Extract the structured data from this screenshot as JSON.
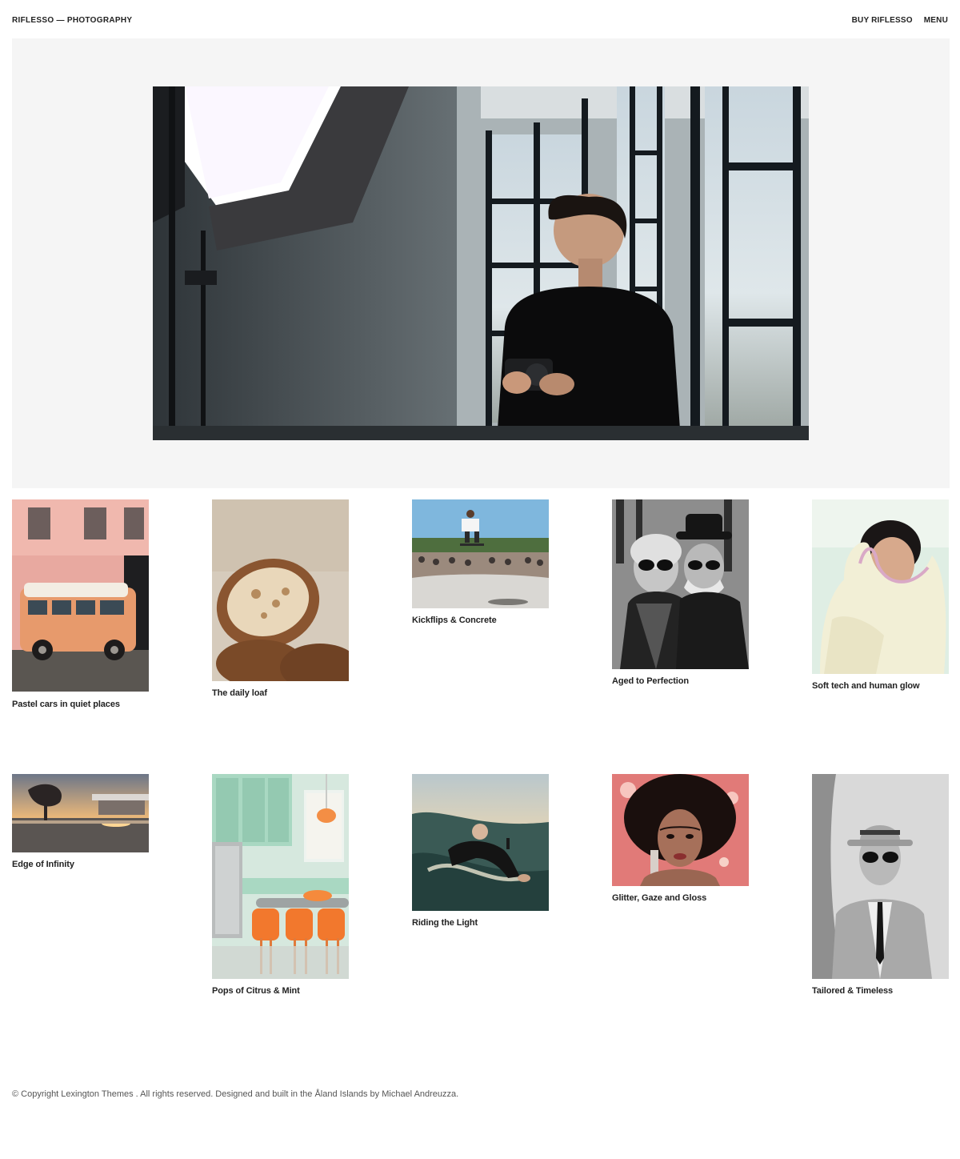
{
  "header": {
    "brand": "RIFLESSO — PHOTOGRAPHY",
    "nav": [
      {
        "label": "BUY RIFLESSO"
      },
      {
        "label": "MENU"
      }
    ]
  },
  "gallery": [
    {
      "title": "Pastel cars in quiet places"
    },
    {
      "title": "The daily loaf"
    },
    {
      "title": "Kickflips & Concrete"
    },
    {
      "title": "Aged to Perfection"
    },
    {
      "title": "Soft tech and human glow"
    },
    {
      "title": "Edge of Infinity"
    },
    {
      "title": "Pops of Citrus & Mint"
    },
    {
      "title": "Riding the Light"
    },
    {
      "title": "Glitter, Gaze and Gloss"
    },
    {
      "title": "Tailored & Timeless"
    }
  ],
  "footer": {
    "text": "© Copyright Lexington Themes . All rights reserved. Designed and built in the Åland Islands by Michael Andreuzza."
  }
}
